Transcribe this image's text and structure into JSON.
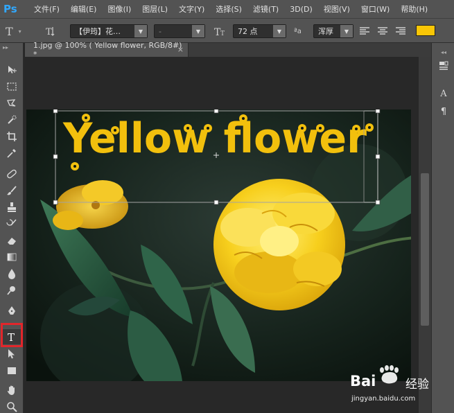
{
  "app": {
    "logo": "Ps"
  },
  "menu": [
    "文件(F)",
    "编辑(E)",
    "图像(I)",
    "图层(L)",
    "文字(Y)",
    "选择(S)",
    "滤镜(T)",
    "3D(D)",
    "视图(V)",
    "窗口(W)",
    "帮助(H)"
  ],
  "options": {
    "font_family": "【伊筠】花…",
    "font_style": "-",
    "font_size": "72 点",
    "antialias_prefix": "ªa",
    "antialias": "浑厚",
    "text_color": "#f9c606"
  },
  "document": {
    "tab_title": "1.jpg @ 100% ( Yellow flower, RGB/8#) *",
    "tab_close": "×",
    "text_layer": "Yellow flower",
    "text_color": "#f2c00d"
  },
  "dock": {
    "character_label": "A",
    "paragraph_label": "¶"
  },
  "watermark": {
    "brand": "Bai",
    "brand_suffix": "经验",
    "url": "jingyan.baidu.com"
  },
  "icons": [
    "move-icon",
    "marquee-icon",
    "lasso-icon",
    "quick-select-icon",
    "crop-icon",
    "eyedropper-icon",
    "healing-icon",
    "brush-icon",
    "stamp-icon",
    "history-brush-icon",
    "eraser-icon",
    "gradient-icon",
    "blur-icon",
    "dodge-icon",
    "pen-icon",
    "type-icon",
    "path-select-icon",
    "rectangle-icon",
    "hand-icon",
    "zoom-icon"
  ]
}
